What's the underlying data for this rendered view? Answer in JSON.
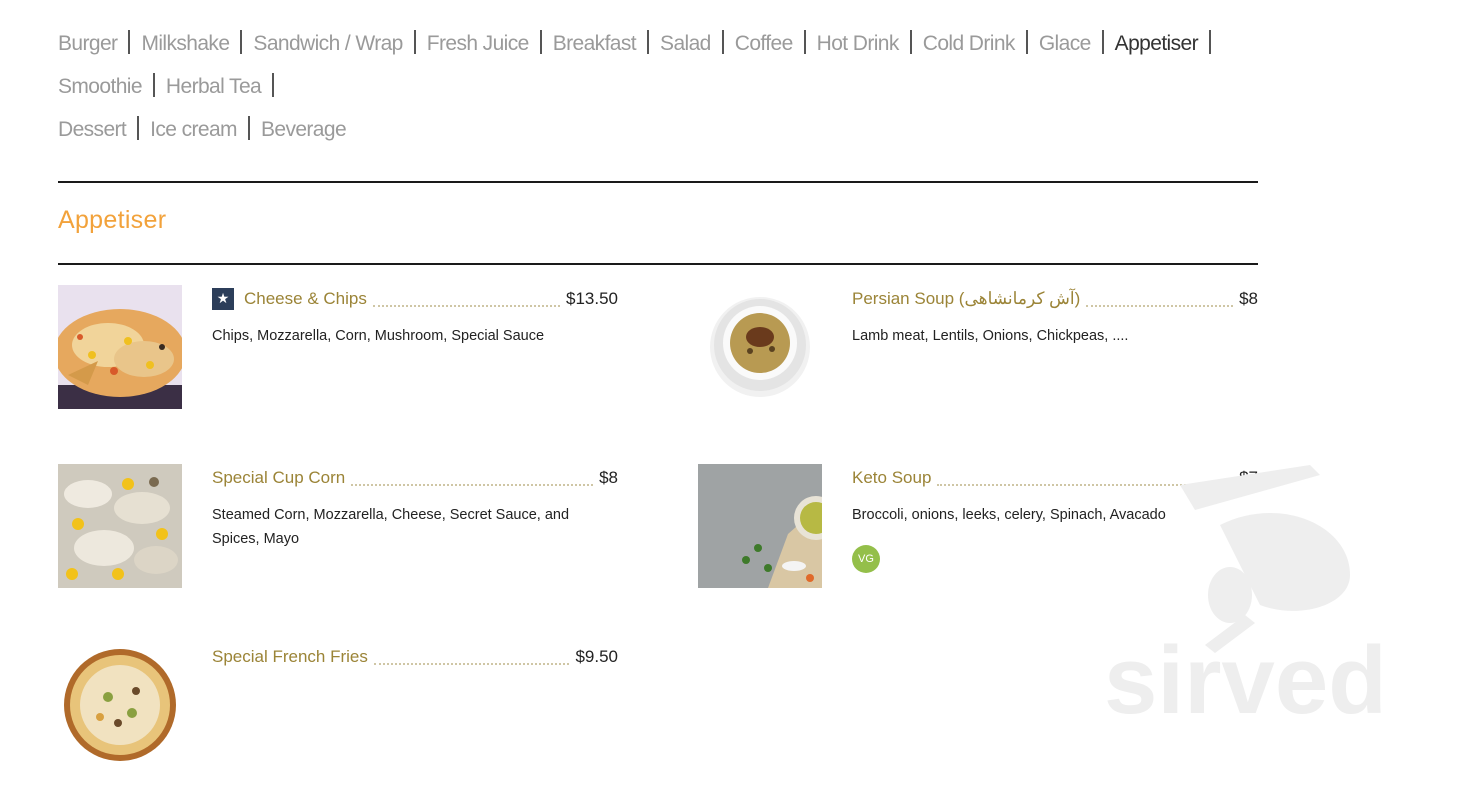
{
  "nav": {
    "categories": [
      "Burger",
      "Milkshake",
      "Sandwich / Wrap",
      "Fresh Juice",
      "Breakfast",
      "Salad",
      "Coffee",
      "Hot Drink",
      "Cold Drink",
      "Glace",
      "Appetiser",
      "Smoothie",
      "Herbal Tea",
      "Dessert",
      "Ice cream",
      "Beverage"
    ],
    "active": "Appetiser"
  },
  "section": {
    "title": "Appetiser"
  },
  "items": [
    {
      "name": "Cheese & Chips",
      "price": "$13.50",
      "desc": "Chips, Mozzarella, Corn, Mushroom, Special Sauce",
      "featured": true
    },
    {
      "name": "Persian Soup (آش کرمانشاهی)",
      "price": "$8",
      "desc": "Lamb meat, Lentils, Onions, Chickpeas, ...."
    },
    {
      "name": "Special Cup Corn",
      "price": "$8",
      "desc": "Steamed Corn, Mozzarella, Cheese, Secret Sauce, and Spices, Mayo"
    },
    {
      "name": "Keto Soup",
      "price": "$7",
      "desc": "Broccoli, onions, leeks, celery, Spinach, Avacado",
      "badge": "VG"
    },
    {
      "name": "Special French Fries",
      "price": "$9.50",
      "desc": ""
    }
  ],
  "watermark": {
    "text": "sirved"
  },
  "colors": {
    "accent": "#f2a23b",
    "item_name": "#9b8437",
    "vg": "#94bf4a",
    "star_badge": "#2c3e5a"
  }
}
